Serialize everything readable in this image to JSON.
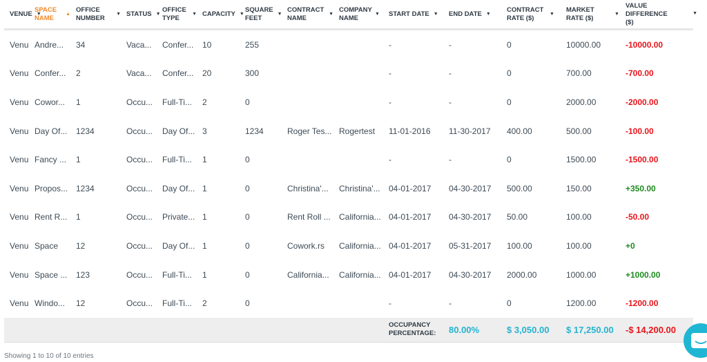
{
  "columns": [
    {
      "label": "VENUE",
      "sort": "down"
    },
    {
      "label": "SPACE NAME",
      "sort": "up",
      "active": true
    },
    {
      "label": "OFFICE NUMBER",
      "sort": "down"
    },
    {
      "label": "STATUS",
      "sort": "down"
    },
    {
      "label": "OFFICE TYPE",
      "sort": "down"
    },
    {
      "label": "CAPACITY",
      "sort": "down"
    },
    {
      "label": "SQUARE FEET",
      "sort": "down"
    },
    {
      "label": "CONTRACT NAME",
      "sort": "down"
    },
    {
      "label": "COMPANY NAME",
      "sort": "down"
    },
    {
      "label": "START DATE",
      "sort": "down"
    },
    {
      "label": "END DATE",
      "sort": "down"
    },
    {
      "label": "CONTRACT RATE ($)",
      "sort": "down"
    },
    {
      "label": "MARKET RATE ($)",
      "sort": "down"
    },
    {
      "label": "VALUE DIFFERENCE ($)",
      "sort": "down"
    }
  ],
  "rows": [
    [
      "Venu...",
      "Andre...",
      "34",
      "Vaca...",
      "Confer...",
      "10",
      "255",
      "",
      "",
      "-",
      "-",
      "0",
      "10000.00",
      "-10000.00"
    ],
    [
      "Venu...",
      "Confer...",
      "2",
      "Vaca...",
      "Confer...",
      "20",
      "300",
      "",
      "",
      "-",
      "-",
      "0",
      "700.00",
      "-700.00"
    ],
    [
      "Venu...",
      "Cowor...",
      "1",
      "Occu...",
      "Full-Ti...",
      "2",
      "0",
      "",
      "",
      "-",
      "-",
      "0",
      "2000.00",
      "-2000.00"
    ],
    [
      "Venu...",
      "Day Of...",
      "1234",
      "Occu...",
      "Day Of...",
      "3",
      "1234",
      "Roger Tes...",
      "Rogertest",
      "11-01-2016",
      "11-30-2017",
      "400.00",
      "500.00",
      "-100.00"
    ],
    [
      "Venu...",
      "Fancy ...",
      "1",
      "Occu...",
      "Full-Ti...",
      "1",
      "0",
      "",
      "",
      "-",
      "-",
      "0",
      "1500.00",
      "-1500.00"
    ],
    [
      "Venu...",
      "Propos...",
      "1234",
      "Occu...",
      "Day Of...",
      "1",
      "0",
      "Christina'...",
      "Christina'...",
      "04-01-2017",
      "04-30-2017",
      "500.00",
      "150.00",
      "+350.00"
    ],
    [
      "Venu...",
      "Rent R...",
      "1",
      "Occu...",
      "Private...",
      "1",
      "0",
      "Rent Roll ...",
      "California...",
      "04-01-2017",
      "04-30-2017",
      "50.00",
      "100.00",
      "-50.00"
    ],
    [
      "Venu...",
      "Space",
      "12",
      "Occu...",
      "Day Of...",
      "1",
      "0",
      "Cowork.rs",
      "California...",
      "04-01-2017",
      "05-31-2017",
      "100.00",
      "100.00",
      "+0"
    ],
    [
      "Venu...",
      "Space ...",
      "123",
      "Occu...",
      "Full-Ti...",
      "1",
      "0",
      "California...",
      "California...",
      "04-01-2017",
      "04-30-2017",
      "2000.00",
      "1000.00",
      "+1000.00"
    ],
    [
      "Venu...",
      "Windo...",
      "12",
      "Occu...",
      "Full-Ti...",
      "2",
      "0",
      "",
      "",
      "-",
      "-",
      "0",
      "1200.00",
      "-1200.00"
    ]
  ],
  "totals": {
    "label": "OCCUPANCY PERCENTAGE:",
    "occupancy": "80.00%",
    "contract_rate": "$ 3,050.00",
    "market_rate": "$ 17,250.00",
    "value_difference": "-$ 14,200.00"
  },
  "footer": {
    "info": "Showing 1 to 10 of 10 entries"
  },
  "colors": {
    "accent": "#f0892a",
    "total": "#25b3d1",
    "negative": "#e8141a",
    "positive": "#1e8a1e",
    "chat": "#1fb6d4"
  },
  "icons": {
    "sort_down": "▼",
    "sort_up": "▲",
    "chat": "chat-bubble-icon"
  }
}
